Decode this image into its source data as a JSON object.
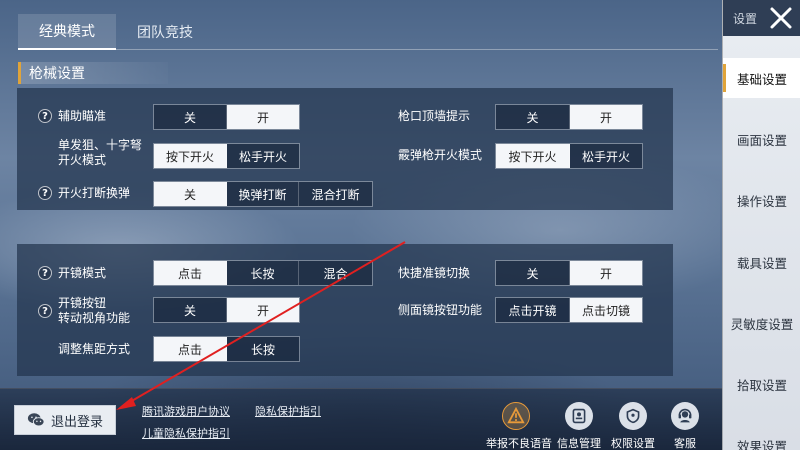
{
  "mode_tabs": [
    {
      "label": "经典模式",
      "active": true
    },
    {
      "label": "团队竞技",
      "active": false
    }
  ],
  "section_title": "枪械设置",
  "panel1": {
    "aim_assist": {
      "label": "辅助瞄准",
      "options": [
        "关",
        "开"
      ],
      "selected": "开"
    },
    "muzzle_wall": {
      "label": "枪口顶墙提示",
      "options": [
        "关",
        "开"
      ],
      "selected": "开"
    },
    "sniper_fire": {
      "label_line1": "单发狙、十字弩",
      "label_line2": "开火模式",
      "options": [
        "按下开火",
        "松手开火"
      ],
      "selected": "按下开火"
    },
    "shotgun_fire": {
      "label": "霰弹枪开火模式",
      "options": [
        "按下开火",
        "松手开火"
      ],
      "selected": "按下开火"
    },
    "fire_reload": {
      "label": "开火打断换弹",
      "options": [
        "关",
        "换弹打断",
        "混合打断"
      ],
      "selected": "关"
    }
  },
  "panel2": {
    "scope_mode": {
      "label": "开镜模式",
      "options": [
        "点击",
        "长按",
        "混合"
      ],
      "selected": "点击"
    },
    "quick_scope": {
      "label": "快捷准镜切换",
      "options": [
        "关",
        "开"
      ],
      "selected": "开"
    },
    "scope_rotate": {
      "label_line1": "开镜按钮",
      "label_line2": "转动视角功能",
      "options": [
        "关",
        "开"
      ],
      "selected": "开"
    },
    "side_scope": {
      "label": "侧面镜按钮功能",
      "options": [
        "点击开镜",
        "点击切镜"
      ],
      "selected": "点击切镜"
    },
    "focus_mode": {
      "label": "调整焦距方式",
      "options": [
        "点击",
        "长按"
      ],
      "selected": "点击"
    }
  },
  "sidebar": {
    "title": "设置",
    "items": [
      "基础设置",
      "画面设置",
      "操作设置",
      "载具设置",
      "灵敏度设置",
      "拾取设置",
      "效果设置"
    ],
    "active": "基础设置"
  },
  "bottom": {
    "logout_label": "退出登录",
    "links": [
      "腾讯游戏用户协议",
      "隐私保护指引",
      "儿童隐私保护指引"
    ],
    "icons": [
      {
        "label": "举报不良语音",
        "icon": "warning-icon"
      },
      {
        "label": "信息管理",
        "icon": "id-card-icon"
      },
      {
        "label": "权限设置",
        "icon": "shield-icon"
      },
      {
        "label": "客服",
        "icon": "support-agent-icon"
      }
    ]
  },
  "colors": {
    "accent": "#e0a43a",
    "annotation_arrow": "#e02020",
    "selected_bg": "#f4f6f9"
  }
}
